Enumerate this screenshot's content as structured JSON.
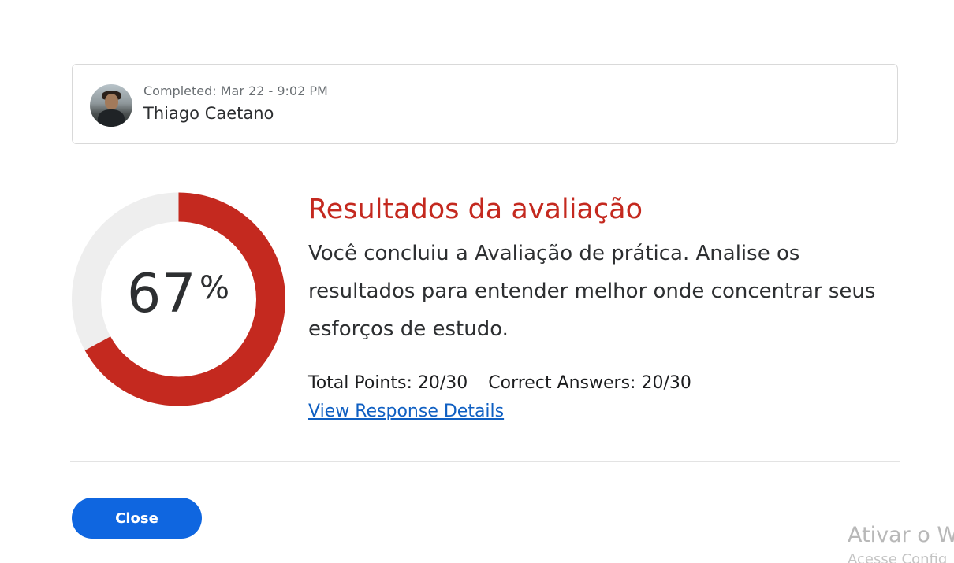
{
  "user": {
    "completed_label": "Completed:",
    "completed_time": "Mar 22 - 9:02 PM",
    "name": "Thiago Caetano"
  },
  "score": {
    "value": "67",
    "sign": "%",
    "fraction": 0.67,
    "color_fill": "#c4291f",
    "color_track": "#eeeeee"
  },
  "results": {
    "title": "Resultados da avaliação",
    "description": "Você concluiu a Avaliação de prática. Analise os resultados para entender melhor onde concentrar seus esforços de estudo.",
    "total_points": "Total Points: 20/30",
    "correct_answers": "Correct Answers: 20/30",
    "details_link": "View Response Details"
  },
  "actions": {
    "close_label": "Close"
  },
  "watermark": {
    "line1": "Ativar o W",
    "line2": "Acesse Config"
  },
  "colors": {
    "accent_red": "#c4291f",
    "button_blue": "#0f66e0",
    "link_blue": "#0f5fc2"
  }
}
